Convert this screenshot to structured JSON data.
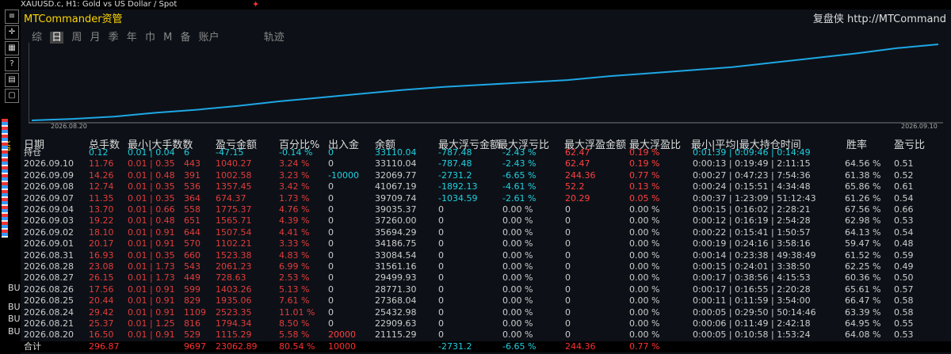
{
  "topbar": {
    "symbol": "XAUUSD.c, H1:  Gold vs US Dollar / Spot"
  },
  "app": {
    "title": "MTCommander资管",
    "brand": "复盘侠 http://MTCommand"
  },
  "tabs": [
    "综",
    "日",
    "周",
    "月",
    "季",
    "年",
    "巾",
    "M",
    "备",
    "账户"
  ],
  "tab_active": "日",
  "tab_track": "轨迹",
  "chart_data": {
    "type": "line",
    "x_start_label": "2026.08.20",
    "x_end_label": "2026.09.10",
    "line_color": "#1ea7e6",
    "values": [
      0,
      0.02,
      0.05,
      0.1,
      0.14,
      0.19,
      0.25,
      0.3,
      0.35,
      0.4,
      0.44,
      0.47,
      0.5,
      0.53,
      0.58,
      0.62,
      0.66,
      0.7,
      0.76,
      0.82,
      0.88,
      0.95,
      1.0
    ]
  },
  "headers": {
    "date": "日期",
    "total": "总手数",
    "min": "最小|大手数数",
    "pnl": "盈亏金额",
    "pct": "百分比%",
    "inout": "出入金",
    "balance": "余额",
    "maxfloat_loss": "最大浮亏金额",
    "maxfloat_loss_pct": "最大浮亏比",
    "maxfloat_win": "最大浮盈金额",
    "maxfloat_win_pct": "最大浮盈比",
    "hold": "最小|平均|最大持仓时间",
    "winrate": "胜率",
    "pl_ratio": "盈亏比"
  },
  "rows": [
    {
      "date": "持仓",
      "total": "0.12",
      "min": "0.01 | 0.04",
      "cnt": "6",
      "pnl": "-47.15",
      "pct": "-0.14 %",
      "inout": "0",
      "bal": "33110.04",
      "mfl": "-787.48",
      "mflp": "-2.43 %",
      "mfw": "62.47",
      "mfwp": "0.19 %",
      "hold": "0:01:39 | 0:09:46 | 0:14:49",
      "wr": "",
      "pl": "",
      "color": "cyan"
    },
    {
      "date": "2026.09.10",
      "total": "11.76",
      "min": "0.01 | 0.35",
      "cnt": "443",
      "pnl": "1040.27",
      "pct": "3.24 %",
      "inout": "0",
      "bal": "33110.04",
      "mfl": "-787.48",
      "mflp": "-2.43 %",
      "mfw": "62.47",
      "mfwp": "0.19 %",
      "hold": "0:00:13 | 0:19:49 | 2:11:15",
      "wr": "64.56 %",
      "pl": "0.51",
      "color": "red"
    },
    {
      "date": "2026.09.09",
      "total": "14.26",
      "min": "0.01 | 0.48",
      "cnt": "391",
      "pnl": "1002.58",
      "pct": "3.23 %",
      "inout": "-10000",
      "bal": "32069.77",
      "mfl": "-2731.2",
      "mflp": "-6.65 %",
      "mfw": "244.36",
      "mfwp": "0.77 %",
      "hold": "0:00:27 | 0:47:23 | 7:54:36",
      "wr": "61.38 %",
      "pl": "0.52",
      "color": "red"
    },
    {
      "date": "2026.09.08",
      "total": "12.74",
      "min": "0.01 | 0.35",
      "cnt": "536",
      "pnl": "1357.45",
      "pct": "3.42 %",
      "inout": "0",
      "bal": "41067.19",
      "mfl": "-1892.13",
      "mflp": "-4.61 %",
      "mfw": "52.2",
      "mfwp": "0.13 %",
      "hold": "0:00:24 | 0:15:51 | 4:34:48",
      "wr": "65.86 %",
      "pl": "0.61",
      "color": "red"
    },
    {
      "date": "2026.09.07",
      "total": "11.35",
      "min": "0.01 | 0.35",
      "cnt": "364",
      "pnl": "674.37",
      "pct": "1.73 %",
      "inout": "0",
      "bal": "39709.74",
      "mfl": "-1034.59",
      "mflp": "-2.61 %",
      "mfw": "20.29",
      "mfwp": "0.05 %",
      "hold": "0:00:37 | 1:23:09 | 51:12:43",
      "wr": "61.26 %",
      "pl": "0.54",
      "color": "red"
    },
    {
      "date": "2026.09.04",
      "total": "13.70",
      "min": "0.01 | 0.66",
      "cnt": "558",
      "pnl": "1775.37",
      "pct": "4.76 %",
      "inout": "0",
      "bal": "39035.37",
      "mfl": "0",
      "mflp": "0.00 %",
      "mfw": "0",
      "mfwp": "0.00 %",
      "hold": "0:00:15 | 0:16:02 | 2:28:21",
      "wr": "67.56 %",
      "pl": "0.66",
      "color": "red"
    },
    {
      "date": "2026.09.03",
      "total": "19.22",
      "min": "0.01 | 0.48",
      "cnt": "651",
      "pnl": "1565.71",
      "pct": "4.39 %",
      "inout": "0",
      "bal": "37260.00",
      "mfl": "0",
      "mflp": "0.00 %",
      "mfw": "0",
      "mfwp": "0.00 %",
      "hold": "0:00:12 | 0:16:19 | 2:54:28",
      "wr": "62.98 %",
      "pl": "0.53",
      "color": "red"
    },
    {
      "date": "2026.09.02",
      "total": "18.10",
      "min": "0.01 | 0.91",
      "cnt": "644",
      "pnl": "1507.54",
      "pct": "4.41 %",
      "inout": "0",
      "bal": "35694.29",
      "mfl": "0",
      "mflp": "0.00 %",
      "mfw": "0",
      "mfwp": "0.00 %",
      "hold": "0:00:22 | 0:15:41 | 1:50:57",
      "wr": "64.13 %",
      "pl": "0.54",
      "color": "red"
    },
    {
      "date": "2026.09.01",
      "total": "20.17",
      "min": "0.01 | 0.91",
      "cnt": "570",
      "pnl": "1102.21",
      "pct": "3.33 %",
      "inout": "0",
      "bal": "34186.75",
      "mfl": "0",
      "mflp": "0.00 %",
      "mfw": "0",
      "mfwp": "0.00 %",
      "hold": "0:00:19 | 0:24:16 | 3:58:16",
      "wr": "59.47 %",
      "pl": "0.48",
      "color": "red"
    },
    {
      "date": "2026.08.31",
      "total": "16.93",
      "min": "0.01 | 0.35",
      "cnt": "660",
      "pnl": "1523.38",
      "pct": "4.83 %",
      "inout": "0",
      "bal": "33084.54",
      "mfl": "0",
      "mflp": "0.00 %",
      "mfw": "0",
      "mfwp": "0.00 %",
      "hold": "0:00:14 | 0:23:38 | 49:38:49",
      "wr": "61.52 %",
      "pl": "0.59",
      "color": "red"
    },
    {
      "date": "2026.08.28",
      "total": "23.08",
      "min": "0.01 | 1.73",
      "cnt": "543",
      "pnl": "2061.23",
      "pct": "6.99 %",
      "inout": "0",
      "bal": "31561.16",
      "mfl": "0",
      "mflp": "0.00 %",
      "mfw": "0",
      "mfwp": "0.00 %",
      "hold": "0:00:15 | 0:24:01 | 3:38:50",
      "wr": "62.25 %",
      "pl": "0.49",
      "color": "red"
    },
    {
      "date": "2026.08.27",
      "total": "26.15",
      "min": "0.01 | 1.73",
      "cnt": "449",
      "pnl": "728.63",
      "pct": "2.53 %",
      "inout": "0",
      "bal": "29499.93",
      "mfl": "0",
      "mflp": "0.00 %",
      "mfw": "0",
      "mfwp": "0.00 %",
      "hold": "0:00:17 | 0:38:56 | 4:15:53",
      "wr": "60.36 %",
      "pl": "0.50",
      "color": "red"
    },
    {
      "date": "2026.08.26",
      "total": "17.56",
      "min": "0.01 | 0.91",
      "cnt": "599",
      "pnl": "1403.26",
      "pct": "5.13 %",
      "inout": "0",
      "bal": "28771.30",
      "mfl": "0",
      "mflp": "0.00 %",
      "mfw": "0",
      "mfwp": "0.00 %",
      "hold": "0:00:17 | 0:16:55 | 2:20:28",
      "wr": "65.61 %",
      "pl": "0.57",
      "color": "red"
    },
    {
      "date": "2026.08.25",
      "total": "20.44",
      "min": "0.01 | 0.91",
      "cnt": "829",
      "pnl": "1935.06",
      "pct": "7.61 %",
      "inout": "0",
      "bal": "27368.04",
      "mfl": "0",
      "mflp": "0.00 %",
      "mfw": "0",
      "mfwp": "0.00 %",
      "hold": "0:00:11 | 0:11:59 | 3:54:00",
      "wr": "66.47 %",
      "pl": "0.58",
      "color": "red"
    },
    {
      "date": "2026.08.24",
      "total": "29.42",
      "min": "0.01 | 0.91",
      "cnt": "1109",
      "pnl": "2523.35",
      "pct": "11.01 %",
      "inout": "0",
      "bal": "25432.98",
      "mfl": "0",
      "mflp": "0.00 %",
      "mfw": "0",
      "mfwp": "0.00 %",
      "hold": "0:00:05 | 0:29:50 | 50:14:46",
      "wr": "63.39 %",
      "pl": "0.58",
      "color": "red"
    },
    {
      "date": "2026.08.21",
      "total": "25.37",
      "min": "0.01 | 1.25",
      "cnt": "816",
      "pnl": "1794.34",
      "pct": "8.50 %",
      "inout": "0",
      "bal": "22909.63",
      "mfl": "0",
      "mflp": "0.00 %",
      "mfw": "0",
      "mfwp": "0.00 %",
      "hold": "0:00:06 | 0:11:49 | 2:42:18",
      "wr": "64.95 %",
      "pl": "0.55",
      "color": "red"
    },
    {
      "date": "2026.08.20",
      "total": "16.50",
      "min": "0.01 | 0.91",
      "cnt": "529",
      "pnl": "1115.29",
      "pct": "5.58 %",
      "inout": "20000",
      "bal": "21115.29",
      "mfl": "0",
      "mflp": "0.00 %",
      "mfw": "0",
      "mfwp": "0.00 %",
      "hold": "0:00:05 | 0:10:58 | 1:53:24",
      "wr": "64.08 %",
      "pl": "0.53",
      "color": "red"
    },
    {
      "date": "合计",
      "total": "296.87",
      "min": "",
      "cnt": "9697",
      "pnl": "23062.89",
      "pct": "80.54 %",
      "inout": "10000",
      "bal": "",
      "mfl": "-2731.2",
      "mflp": "-6.65 %",
      "mfw": "244.36",
      "mfwp": "0.77 %",
      "hold": "",
      "wr": "",
      "pl": "",
      "color": "total"
    }
  ],
  "left_labels": [
    "V8",
    "BU",
    "BU",
    "BU",
    "BU"
  ]
}
